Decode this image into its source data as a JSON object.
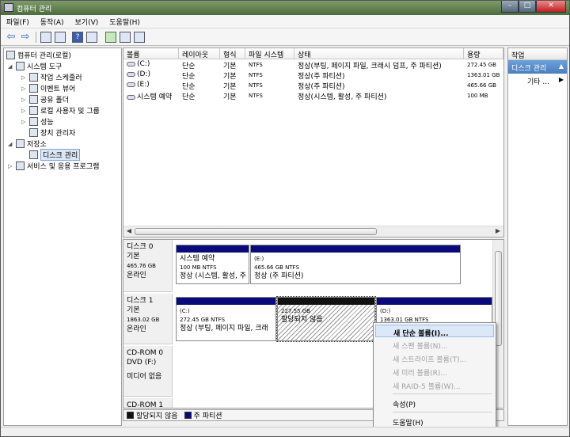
{
  "window": {
    "title": "컴퓨터 관리",
    "min": "–",
    "max": "□",
    "close": "✕"
  },
  "menu": [
    "파일(F)",
    "동작(A)",
    "보기(V)",
    "도움말(H)"
  ],
  "toolbar": {
    "help": "?"
  },
  "tree": [
    {
      "label": "컴퓨터 관리(로컬)",
      "level": 0,
      "exp": "",
      "icon": "computer-icon"
    },
    {
      "label": "시스템 도구",
      "level": 1,
      "exp": "◢",
      "icon": "tools-icon"
    },
    {
      "label": "작업 스케줄러",
      "level": 2,
      "exp": "▷",
      "icon": "clock-icon"
    },
    {
      "label": "이벤트 뷰어",
      "level": 2,
      "exp": "▷",
      "icon": "event-viewer-icon"
    },
    {
      "label": "공유 폴더",
      "level": 2,
      "exp": "▷",
      "icon": "shared-folder-icon"
    },
    {
      "label": "로컬 사용자 및 그룹",
      "level": 2,
      "exp": "▷",
      "icon": "users-icon"
    },
    {
      "label": "성능",
      "level": 2,
      "exp": "▷",
      "icon": "performance-icon"
    },
    {
      "label": "장치 관리자",
      "level": 2,
      "exp": "",
      "icon": "device-manager-icon"
    },
    {
      "label": "저장소",
      "level": 1,
      "exp": "◢",
      "icon": "storage-icon"
    },
    {
      "label": "디스크 관리",
      "level": 2,
      "exp": "",
      "icon": "disk-management-icon",
      "selected": true
    },
    {
      "label": "서비스 및 응용 프로그램",
      "level": 1,
      "exp": "▷",
      "icon": "services-icon"
    }
  ],
  "columns": [
    "볼륨",
    "레이아웃",
    "형식",
    "파일 시스템",
    "상태",
    "용량"
  ],
  "volumes": [
    {
      "name": "(C:)",
      "layout": "단순",
      "type": "기본",
      "fs": "NTFS",
      "status": "정상(부팅, 페이지 파일, 크래시 덤프, 주 파티션)",
      "capacity": "272.45 GB"
    },
    {
      "name": "(D:)",
      "layout": "단순",
      "type": "기본",
      "fs": "NTFS",
      "status": "정상(주 파티션)",
      "capacity": "1363.01 GB"
    },
    {
      "name": "(E:)",
      "layout": "단순",
      "type": "기본",
      "fs": "NTFS",
      "status": "정상(주 파티션)",
      "capacity": "465.66 GB"
    },
    {
      "name": "시스템 예약",
      "layout": "단순",
      "type": "기본",
      "fs": "NTFS",
      "status": "정상(시스템, 활성, 주 파티션)",
      "capacity": "100 MB"
    }
  ],
  "disks": [
    {
      "name": "디스크 0",
      "kind": "기본",
      "size": "465.76 GB",
      "state": "온라인"
    },
    {
      "name": "디스크 1",
      "kind": "기본",
      "size": "1863.02 GB",
      "state": "온라인"
    },
    {
      "name": "CD-ROM 0",
      "kind": "DVD (F:)",
      "size": "",
      "state": "미디어 없음"
    },
    {
      "name": "CD-ROM 1",
      "kind": "",
      "size": "",
      "state": ""
    }
  ],
  "partitions": {
    "d0_sys": {
      "title": "시스템 예약",
      "size": "100 MB NTFS",
      "status": "정상 (시스템, 활성, 주"
    },
    "d0_e": {
      "title": "(E:)",
      "size": "465.66 GB NTFS",
      "status": "정상 (주 파티션)"
    },
    "d1_c": {
      "title": "(C:)",
      "size": "272.45 GB NTFS",
      "status": "정상 (부팅, 페이지 파일, 크래"
    },
    "d1_un": {
      "size": "227.55 GB",
      "status": "할당되지 않음"
    },
    "d1_d": {
      "title": "(D:)",
      "size": "1363.01 GB NTFS",
      "status": ""
    }
  },
  "legend": {
    "unallocated": "할당되지 않음",
    "primary": "주 파티션"
  },
  "actions": {
    "header": "작업",
    "section": "디스크 관리",
    "more": "기타 ..."
  },
  "context_menu": {
    "new_simple": "새 단순 볼륨(I)...",
    "new_spanned": "새 스팬 볼륨(N)...",
    "new_striped": "새 스트라이프 볼륨(T)...",
    "new_mirror": "새 미러 볼륨(R)...",
    "new_raid5": "새 RAID-5 볼륨(W)...",
    "properties": "속성(P)",
    "help": "도움말(H)"
  },
  "colors": {
    "primary_partition": "#0a0a7a",
    "unallocated": "#111111",
    "accent": "#4a7fbf"
  }
}
